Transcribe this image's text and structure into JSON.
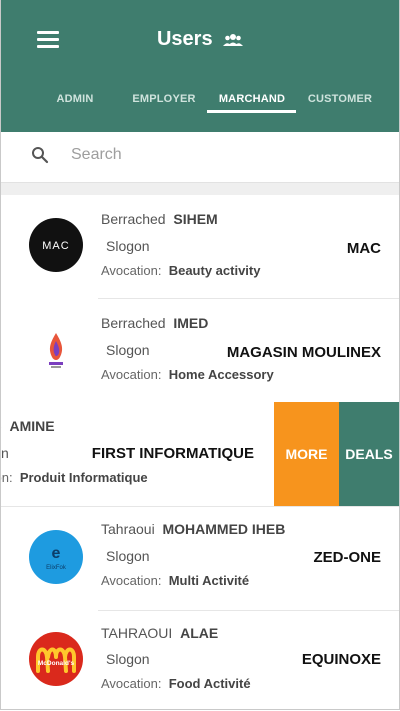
{
  "header": {
    "title": "Users",
    "menu_icon": "hamburger-menu-icon",
    "title_icon": "users-group-icon",
    "background": "#3f7d6e"
  },
  "tabs": [
    {
      "label": "ADMIN",
      "active": false
    },
    {
      "label": "EMPLOYER",
      "active": false
    },
    {
      "label": "MARCHAND",
      "active": true
    },
    {
      "label": "CUSTOMER",
      "active": false
    }
  ],
  "search": {
    "placeholder": "Search",
    "value": ""
  },
  "users": [
    {
      "last_name": "Berrached",
      "first_name": "SIHEM",
      "slogon": "Slogon",
      "avocation_label": "Avocation:",
      "avocation": "Beauty activity",
      "company": "MAC",
      "logo": "mac-logo"
    },
    {
      "last_name": "Berrached",
      "first_name": "IMED",
      "slogon": "Slogon",
      "avocation_label": "Avocation:",
      "avocation": "Home Accessory",
      "company": "MAGASIN MOULINEX",
      "logo": "flame-logo"
    },
    {
      "last_name": "...ine",
      "first_name": "AMINE",
      "slogon": "...n",
      "avocation_label": "...tion:",
      "avocation": "Produit Informatique",
      "company": "FIRST INFORMATIQUE",
      "logo": ""
    },
    {
      "last_name": "Tahraoui",
      "first_name": "MOHAMMED IHEB",
      "slogon": "Slogon",
      "avocation_label": "Avocation:",
      "avocation": "Multi Activité",
      "company": "ZED-ONE",
      "logo": "elixfok-logo"
    },
    {
      "last_name": "TAHRAOUI",
      "first_name": "ALAE",
      "slogon": "Slogon",
      "avocation_label": "Avocation:",
      "avocation": "Food Activité",
      "company": "EQUINOXE",
      "logo": "mcdonalds-logo"
    }
  ],
  "swipe_actions": {
    "more": "MORE",
    "deals": "DEALS",
    "more_color": "#f7941d",
    "deals_color": "#3f7d6e"
  },
  "logos": {
    "mac_text": "MAC",
    "elixfok_text": "ElixFok",
    "mcd_text": "McDonald's"
  },
  "swiped_partial": {
    "last": "ine",
    "slogon": "n",
    "avocation_label": "tion:"
  }
}
